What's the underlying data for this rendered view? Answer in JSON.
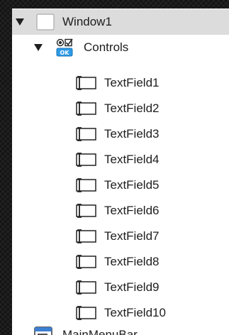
{
  "tree": {
    "window": {
      "label": "Window1",
      "expanded": true,
      "icon": "window-icon"
    },
    "controls": {
      "label": "Controls",
      "expanded": true,
      "icon": "controls-icon"
    },
    "fields": [
      {
        "label": "TextField1",
        "icon": "textfield-icon"
      },
      {
        "label": "TextField2",
        "icon": "textfield-icon"
      },
      {
        "label": "TextField3",
        "icon": "textfield-icon"
      },
      {
        "label": "TextField4",
        "icon": "textfield-icon"
      },
      {
        "label": "TextField5",
        "icon": "textfield-icon"
      },
      {
        "label": "TextField6",
        "icon": "textfield-icon"
      },
      {
        "label": "TextField7",
        "icon": "textfield-icon"
      },
      {
        "label": "TextField8",
        "icon": "textfield-icon"
      },
      {
        "label": "TextField9",
        "icon": "textfield-icon"
      },
      {
        "label": "TextField10",
        "icon": "textfield-icon"
      }
    ],
    "next_item": {
      "label": "MainMenuBar",
      "icon": "menubar-icon"
    }
  },
  "colors": {
    "selection": "#dcdcdc",
    "panel": "#ffffff",
    "text": "#1d1d1d",
    "controls_badge": "#2d9be8"
  }
}
